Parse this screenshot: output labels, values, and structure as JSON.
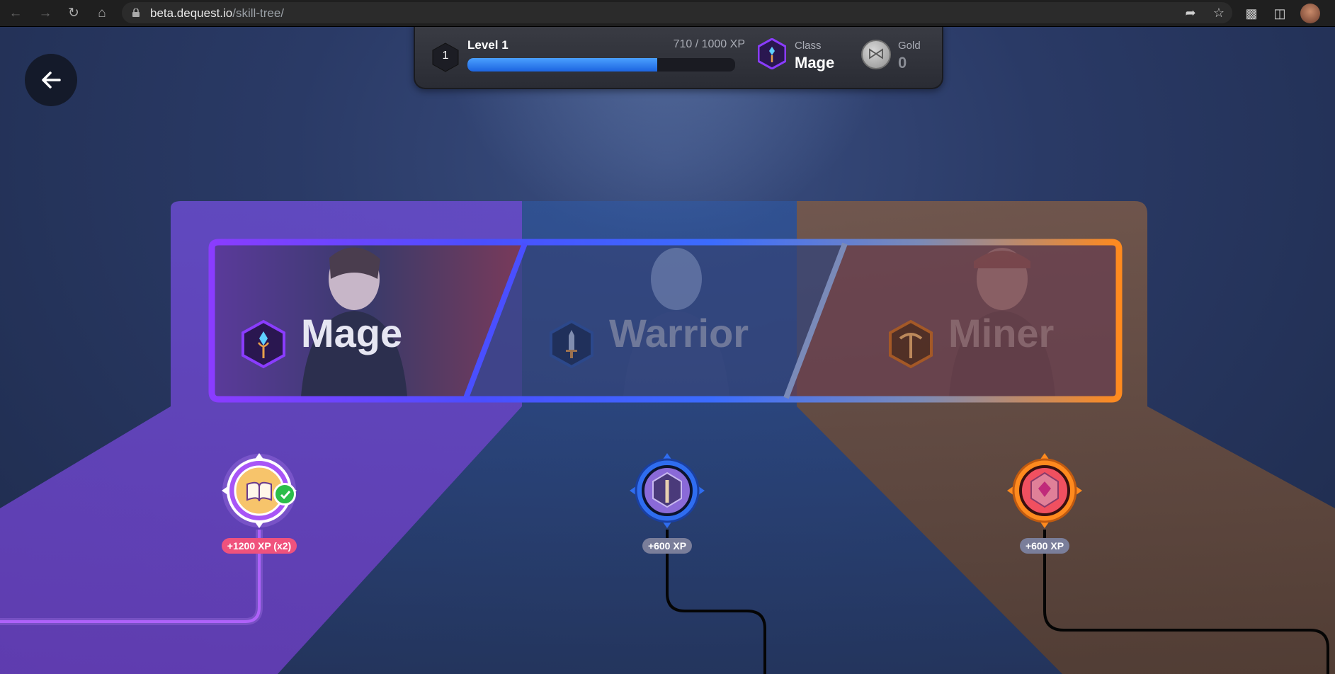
{
  "browser": {
    "url_host": "beta.dequest.io",
    "url_path": "/skill-tree/"
  },
  "icons": {
    "back": "arrow-left-icon",
    "nav_back": "chevron-left-icon",
    "nav_forward": "chevron-right-icon",
    "reload": "reload-icon",
    "home": "home-icon",
    "lock": "lock-icon",
    "share": "share-icon",
    "bookmark": "star-icon",
    "extensions": "puzzle-icon",
    "sidebar": "sidebar-icon"
  },
  "hud": {
    "level_number": "1",
    "level_label": "Level 1",
    "xp_text": "710 / 1000 XP",
    "xp_progress": 0.71,
    "class_label": "Class",
    "class_value": "Mage",
    "gold_label": "Gold",
    "gold_value": "0"
  },
  "classes": [
    {
      "name": "Mage",
      "icon": "crystal-staff-icon",
      "color": "#8a3cff"
    },
    {
      "name": "Warrior",
      "icon": "sword-icon",
      "color": "#3b6cff"
    },
    {
      "name": "Miner",
      "icon": "pickaxe-icon",
      "color": "#ff8a1e"
    }
  ],
  "nodes": [
    {
      "label": "+1200 XP (x2)",
      "completed": true,
      "icon": "book-icon",
      "color": "#a855f7"
    },
    {
      "label": "+600 XP",
      "completed": false,
      "icon": "shield-sword-icon",
      "color": "#2f6df0"
    },
    {
      "label": "+600 XP",
      "completed": false,
      "icon": "gem-icon",
      "color": "#ff8a1e"
    }
  ],
  "colors": {
    "mage": "#8a3cff",
    "warrior": "#3b6cff",
    "miner": "#ff8a1e",
    "xp_bar": "#2f7cf0",
    "completed_badge": "#f0527d",
    "check": "#2bbd4a"
  }
}
